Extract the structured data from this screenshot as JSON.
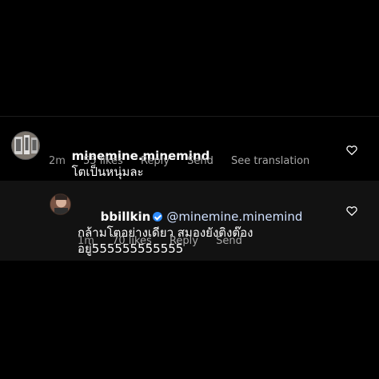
{
  "comment": {
    "username": "minemine.minemind",
    "text": "โตเป็นหนุ่มละ",
    "time": "2m",
    "likes": "55 likes",
    "reply": "Reply",
    "send": "Send",
    "see_translation": "See translation"
  },
  "reply": {
    "username": "bbillkin",
    "mention": "@minemine.minemind",
    "text": " กล้ามโตอย่างเดียว สมองยังติงต๊องอยู่555555555555",
    "time": "1m",
    "likes": "70 likes",
    "reply": "Reply",
    "send": "Send"
  },
  "colors": {
    "background": "#000000",
    "reply_background": "#121212",
    "meta_text": "#9b9b9b",
    "verified_badge": "#2d8cff"
  },
  "icons": {
    "heart": "heart-icon",
    "verified": "verified-badge-icon"
  }
}
